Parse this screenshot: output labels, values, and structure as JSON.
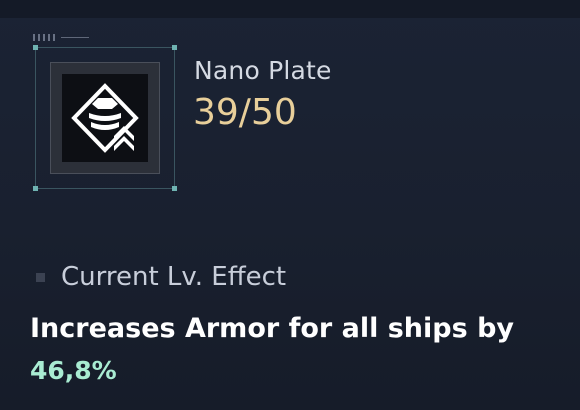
{
  "item": {
    "name": "Nano Plate",
    "level": "39/50",
    "icon": "nano-plate-armor-icon"
  },
  "effect": {
    "header": "Current Lv. Effect",
    "description": "Increases Armor for all ships by",
    "value": "46,8%"
  },
  "colors": {
    "level": "#e8cf9a",
    "value": "#a9ecd2",
    "frame_accent": "#6fb3b2"
  }
}
